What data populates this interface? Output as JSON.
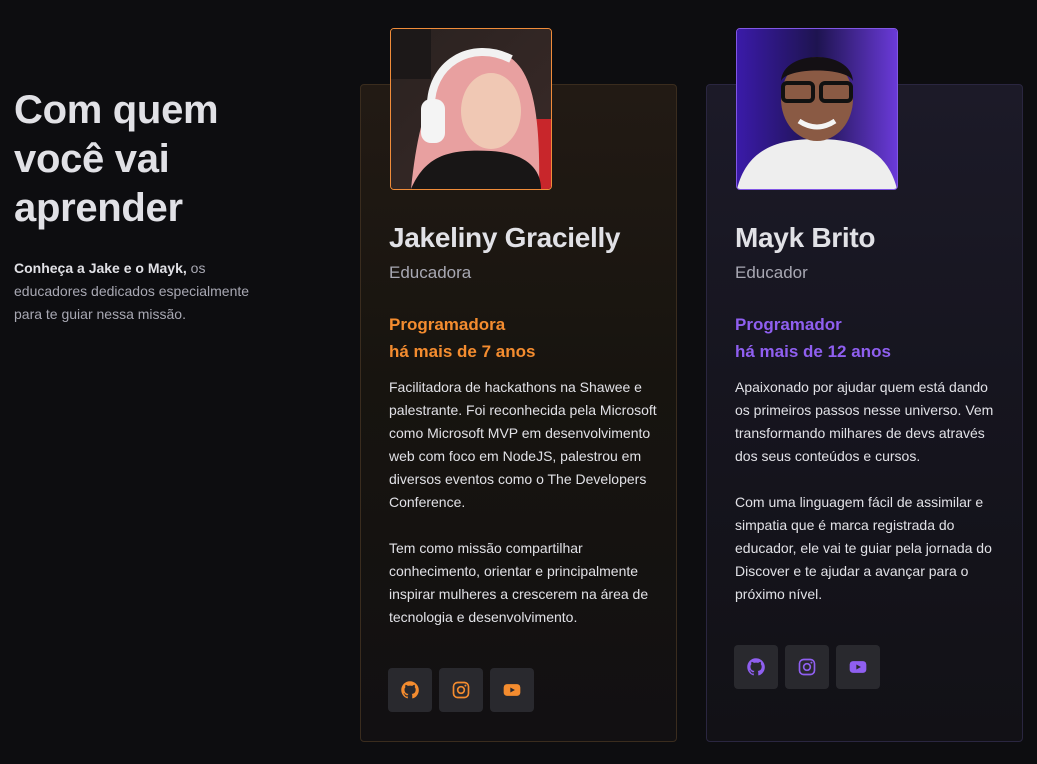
{
  "intro": {
    "title_line1": "Com quem",
    "title_line2": "você vai",
    "title_line3": "aprender",
    "desc_bold": "Conheça a Jake e o Mayk,",
    "desc_rest": " os educadores dedicados especialmente para te guiar nessa missão."
  },
  "educators": [
    {
      "name": "Jakeliny Gracielly",
      "role": "Educadora",
      "exp_line1": "Programadora",
      "exp_line2": "há mais de 7 anos",
      "bio1": "Facilitadora de hackathons na Shawee e palestrante. Foi reconhecida pela Microsoft como Microsoft MVP em desenvolvimento web com foco em NodeJS, palestrou em diversos eventos como o The Developers Conference.",
      "bio2": "Tem como missão compartilhar conhecimento, orientar e principalmente inspirar mulheres a crescerem na área de tecnologia e desenvolvimento.",
      "accent": "#f48c2f"
    },
    {
      "name": "Mayk Brito",
      "role": "Educador",
      "exp_line1": "Programador",
      "exp_line2": "há mais de 12 anos",
      "bio1": "Apaixonado por ajudar quem está dando os primeiros passos nesse universo. Vem transformando milhares de devs através dos seus conteúdos e cursos.",
      "bio2": "Com uma linguagem fácil de assimilar e simpatia que é marca registrada do educador, ele vai te guiar pela jornada do Discover e te ajudar a avançar para o próximo nível.",
      "accent": "#8f5ff0"
    }
  ],
  "social_icons": [
    "github-icon",
    "instagram-icon",
    "youtube-icon"
  ]
}
